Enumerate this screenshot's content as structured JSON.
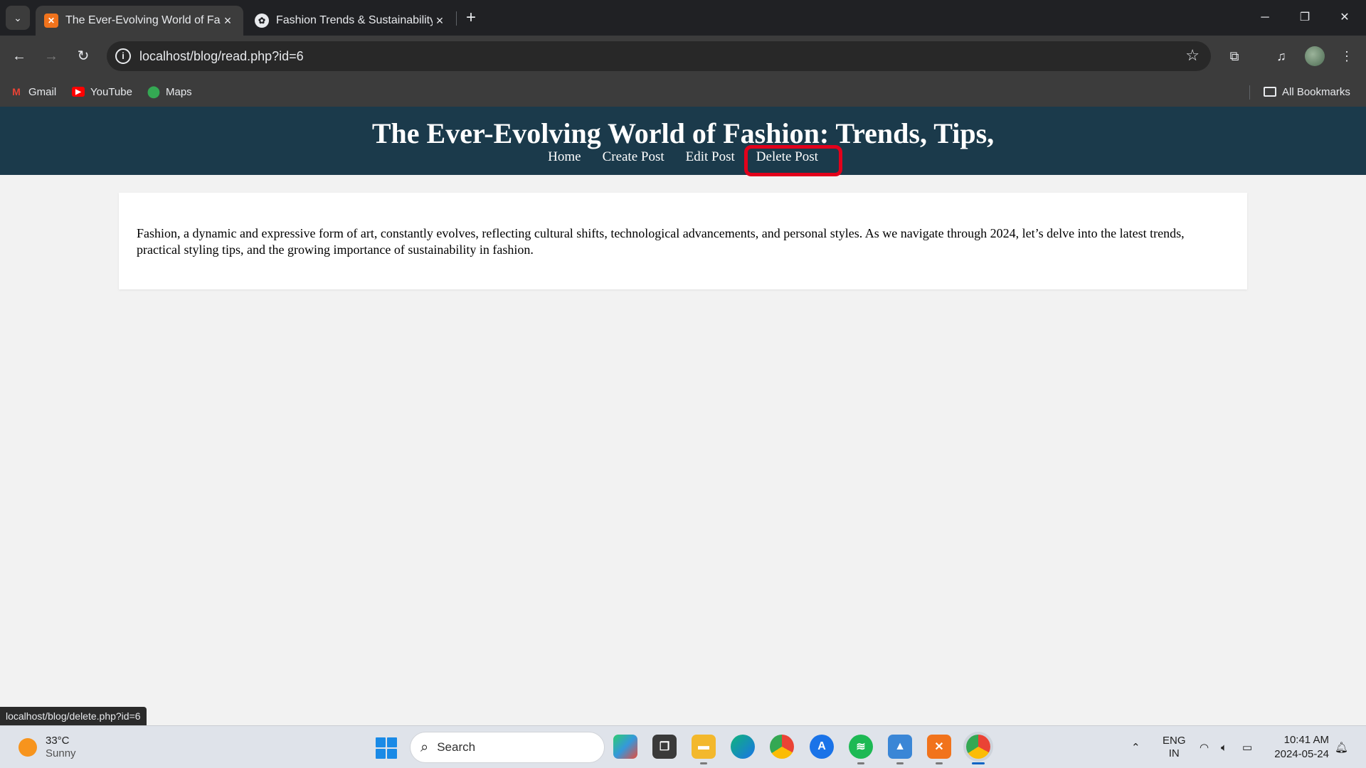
{
  "browser": {
    "tabs": [
      {
        "title": "The Ever-Evolving World of Fashion: Trends, Tips,",
        "favicon": "xampp-icon",
        "active": true
      },
      {
        "title": "Fashion Trends & Sustainability",
        "favicon": "chatgpt-icon",
        "active": false
      }
    ],
    "url": "localhost/blog/read.php?id=6",
    "bookmarks": [
      {
        "label": "Gmail",
        "icon": "gmail-icon"
      },
      {
        "label": "YouTube",
        "icon": "youtube-icon"
      },
      {
        "label": "Maps",
        "icon": "maps-icon"
      }
    ],
    "all_bookmarks_label": "All Bookmarks",
    "status_url": "localhost/blog/delete.php?id=6"
  },
  "site": {
    "title": "The Ever-Evolving World of Fashion: Trends, Tips,",
    "nav": [
      "Home",
      "Create Post",
      "Edit Post",
      "Delete Post"
    ],
    "highlighted_nav": "Delete Post",
    "header_color": "#1b3a4b",
    "highlight_color": "#e3001b"
  },
  "post": {
    "content": "Fashion, a dynamic and expressive form of art, constantly evolves, reflecting cultural shifts, technological advancements, and personal styles. As we navigate through 2024, let’s delve into the latest trends, practical styling tips, and the growing importance of sustainability in fashion."
  },
  "taskbar": {
    "weather_temp": "33°C",
    "weather_desc": "Sunny",
    "search_label": "Search",
    "language_line1": "ENG",
    "language_line2": "IN",
    "time": "10:41 AM",
    "date": "2024-05-24"
  }
}
